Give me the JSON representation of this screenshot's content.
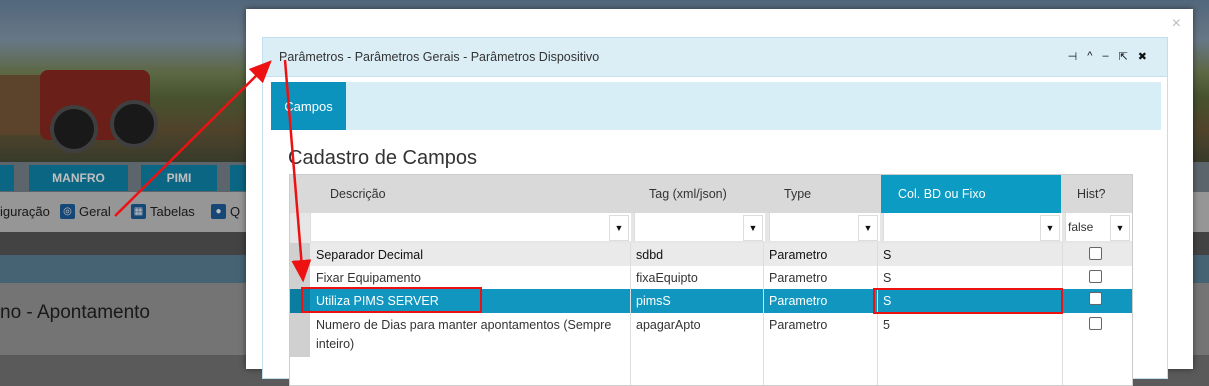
{
  "background": {
    "nav": [
      "MANFRO",
      "PIMI"
    ],
    "toolbar": [
      {
        "label": "iguração",
        "icon": "gear-icon"
      },
      {
        "label": "Geral",
        "icon": "globe-icon"
      },
      {
        "label": "Tabelas",
        "icon": "table-icon"
      },
      {
        "label": "Q",
        "icon": "user-icon"
      }
    ],
    "page_title": "no - Apontamento"
  },
  "modal": {
    "close_glyph": "×",
    "panel_title": "Parâmetros - Parâmetros Gerais - Parâmetros Dispositivo",
    "controls": [
      "⊣",
      "^",
      "–",
      "⇱",
      "✖"
    ],
    "tab": "Campos",
    "section_title": "Cadastro de Campos",
    "grid": {
      "columns": [
        "Descrição",
        "Tag (xml/json)",
        "Type",
        "Col. BD ou Fixo",
        "Hist?"
      ],
      "hist_filter": "false",
      "rows": [
        {
          "descricao": "Separador Decimal",
          "tag": "sdbd",
          "type": "Parametro",
          "col": "S",
          "hist": false
        },
        {
          "descricao": "Fixar Equipamento",
          "tag": "fixaEquipto",
          "type": "Parametro",
          "col": "S",
          "hist": false
        },
        {
          "descricao": "Utiliza PIMS SERVER",
          "tag": "pimsS",
          "type": "Parametro",
          "col": "S",
          "hist": false
        },
        {
          "descricao": "Numero de Dias para manter apontamentos (Sempre",
          "descricao_line2": "inteiro)",
          "tag": "apagarApto",
          "type": "Parametro",
          "col": "5",
          "hist": false
        }
      ]
    }
  },
  "colors": {
    "accent": "#0b93bd",
    "selected_row": "#1197bf",
    "annotation": "#e11111"
  }
}
